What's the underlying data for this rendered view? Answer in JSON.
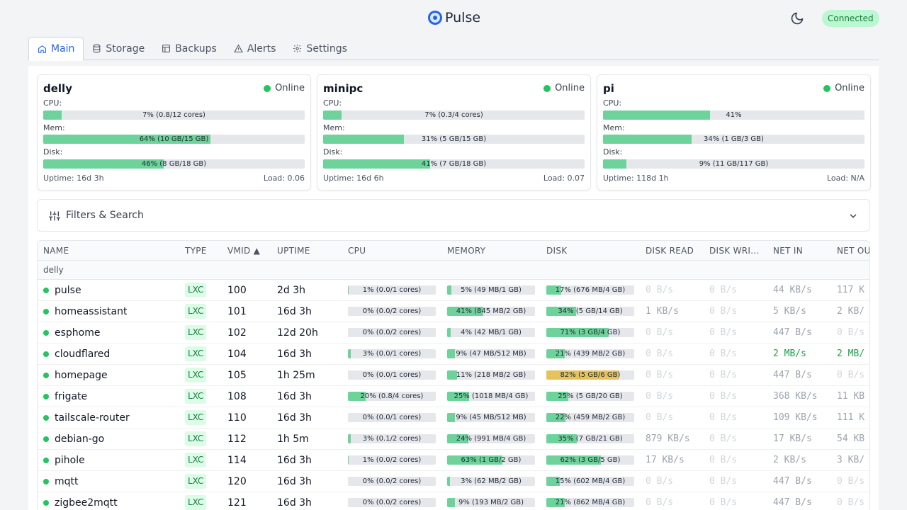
{
  "app": {
    "name": "Pulse",
    "connection_status": "Connected"
  },
  "tabs": [
    {
      "label": "Main",
      "icon": "home-icon",
      "active": true
    },
    {
      "label": "Storage",
      "icon": "database-icon"
    },
    {
      "label": "Backups",
      "icon": "archive-icon"
    },
    {
      "label": "Alerts",
      "icon": "alert-triangle-icon"
    },
    {
      "label": "Settings",
      "icon": "gear-icon"
    }
  ],
  "nodes": [
    {
      "name": "delly",
      "status": "Online",
      "cpu_label": "CPU:",
      "cpu_text": "7% (0.8/12 cores)",
      "cpu_pct": 7,
      "mem_label": "Mem:",
      "mem_text": "64% (10 GB/15 GB)",
      "mem_pct": 64,
      "disk_label": "Disk:",
      "disk_text": "46% (8 GB/18 GB)",
      "disk_pct": 46,
      "uptime": "Uptime: 16d 3h",
      "load": "Load: 0.06"
    },
    {
      "name": "minipc",
      "status": "Online",
      "cpu_label": "CPU:",
      "cpu_text": "7% (0.3/4 cores)",
      "cpu_pct": 7,
      "mem_label": "Mem:",
      "mem_text": "31% (5 GB/15 GB)",
      "mem_pct": 31,
      "disk_label": "Disk:",
      "disk_text": "41% (7 GB/18 GB)",
      "disk_pct": 41,
      "uptime": "Uptime: 16d 6h",
      "load": "Load: 0.07"
    },
    {
      "name": "pi",
      "status": "Online",
      "cpu_label": "CPU:",
      "cpu_text": "41%",
      "cpu_pct": 41,
      "mem_label": "Mem:",
      "mem_text": "34% (1 GB/3 GB)",
      "mem_pct": 34,
      "disk_label": "Disk:",
      "disk_text": "9% (11 GB/117 GB)",
      "disk_pct": 9,
      "uptime": "Uptime: 118d 1h",
      "load": "Load: N/A"
    }
  ],
  "filters": {
    "label": "Filters & Search"
  },
  "table": {
    "headers": [
      "NAME",
      "TYPE",
      "VMID ▲",
      "UPTIME",
      "CPU",
      "MEMORY",
      "DISK",
      "DISK READ",
      "DISK WRI...",
      "NET IN",
      "NET OU"
    ],
    "group": "delly",
    "rows": [
      {
        "name": "pulse",
        "type": "LXC",
        "vmid": "100",
        "uptime": "2d 3h",
        "cpu": "1% (0.0/1 cores)",
        "cpu_pct": 1,
        "mem": "5% (49 MB/1 GB)",
        "mem_pct": 5,
        "disk": "17% (676 MB/4 GB)",
        "disk_pct": 17,
        "dread": "0 B/s",
        "dwrite": "0 B/s",
        "netin": "44 KB/s",
        "netout": "117 K"
      },
      {
        "name": "homeassistant",
        "type": "LXC",
        "vmid": "101",
        "uptime": "16d 3h",
        "cpu": "0% (0.0/2 cores)",
        "cpu_pct": 0,
        "mem": "41% (845 MB/2 GB)",
        "mem_pct": 41,
        "disk": "34% (5 GB/14 GB)",
        "disk_pct": 34,
        "dread": "1 KB/s",
        "dwrite": "0 B/s",
        "netin": "5 KB/s",
        "netout": "2 KB/"
      },
      {
        "name": "esphome",
        "type": "LXC",
        "vmid": "102",
        "uptime": "12d 20h",
        "cpu": "0% (0.0/2 cores)",
        "cpu_pct": 0,
        "mem": "4% (42 MB/1 GB)",
        "mem_pct": 4,
        "disk": "71% (3 GB/4 GB)",
        "disk_pct": 71,
        "dread": "0 B/s",
        "dwrite": "0 B/s",
        "netin": "447 B/s",
        "netout": "0 B/s"
      },
      {
        "name": "cloudflared",
        "type": "LXC",
        "vmid": "104",
        "uptime": "16d 3h",
        "cpu": "3% (0.0/1 cores)",
        "cpu_pct": 3,
        "mem": "9% (47 MB/512 MB)",
        "mem_pct": 9,
        "disk": "21% (439 MB/2 GB)",
        "disk_pct": 21,
        "dread": "0 B/s",
        "dwrite": "0 B/s",
        "netin": "2 MB/s",
        "netout": "2 MB/"
      },
      {
        "name": "homepage",
        "type": "LXC",
        "vmid": "105",
        "uptime": "1h 25m",
        "cpu": "0% (0.0/1 cores)",
        "cpu_pct": 0,
        "mem": "11% (218 MB/2 GB)",
        "mem_pct": 11,
        "disk": "82% (5 GB/6 GB)",
        "disk_pct": 82,
        "dread": "0 B/s",
        "dwrite": "0 B/s",
        "netin": "447 B/s",
        "netout": "0 B/s"
      },
      {
        "name": "frigate",
        "type": "LXC",
        "vmid": "108",
        "uptime": "16d 3h",
        "cpu": "20% (0.8/4 cores)",
        "cpu_pct": 20,
        "mem": "25% (1018 MB/4 GB)",
        "mem_pct": 25,
        "disk": "25% (5 GB/20 GB)",
        "disk_pct": 25,
        "dread": "0 B/s",
        "dwrite": "0 B/s",
        "netin": "368 KB/s",
        "netout": "11 KB"
      },
      {
        "name": "tailscale-router",
        "type": "LXC",
        "vmid": "110",
        "uptime": "16d 3h",
        "cpu": "0% (0.0/1 cores)",
        "cpu_pct": 0,
        "mem": "9% (45 MB/512 MB)",
        "mem_pct": 9,
        "disk": "22% (459 MB/2 GB)",
        "disk_pct": 22,
        "dread": "0 B/s",
        "dwrite": "0 B/s",
        "netin": "109 KB/s",
        "netout": "111 K"
      },
      {
        "name": "debian-go",
        "type": "LXC",
        "vmid": "112",
        "uptime": "1h 5m",
        "cpu": "3% (0.1/2 cores)",
        "cpu_pct": 3,
        "mem": "24% (991 MB/4 GB)",
        "mem_pct": 24,
        "disk": "35% (7 GB/21 GB)",
        "disk_pct": 35,
        "dread": "879 KB/s",
        "dwrite": "0 B/s",
        "netin": "17 KB/s",
        "netout": "54 KB"
      },
      {
        "name": "pihole",
        "type": "LXC",
        "vmid": "114",
        "uptime": "16d 3h",
        "cpu": "1% (0.0/2 cores)",
        "cpu_pct": 1,
        "mem": "63% (1 GB/2 GB)",
        "mem_pct": 63,
        "disk": "62% (3 GB/5 GB)",
        "disk_pct": 62,
        "dread": "17 KB/s",
        "dwrite": "0 B/s",
        "netin": "2 KB/s",
        "netout": "3 KB/"
      },
      {
        "name": "mqtt",
        "type": "LXC",
        "vmid": "120",
        "uptime": "16d 3h",
        "cpu": "0% (0.0/2 cores)",
        "cpu_pct": 0,
        "mem": "3% (62 MB/2 GB)",
        "mem_pct": 3,
        "disk": "15% (602 MB/4 GB)",
        "disk_pct": 15,
        "dread": "0 B/s",
        "dwrite": "0 B/s",
        "netin": "447 B/s",
        "netout": "0 B/s"
      },
      {
        "name": "zigbee2mqtt",
        "type": "LXC",
        "vmid": "121",
        "uptime": "16d 3h",
        "cpu": "0% (0.0/2 cores)",
        "cpu_pct": 0,
        "mem": "9% (193 MB/2 GB)",
        "mem_pct": 9,
        "disk": "21% (862 MB/4 GB)",
        "disk_pct": 21,
        "dread": "0 B/s",
        "dwrite": "0 B/s",
        "netin": "447 B/s",
        "netout": "0 B/s"
      }
    ]
  },
  "colors": {
    "accent": "#2563eb",
    "bar_fill": "#6ed39a",
    "bar_warn": "#e5c35a",
    "online": "#22c55e"
  }
}
